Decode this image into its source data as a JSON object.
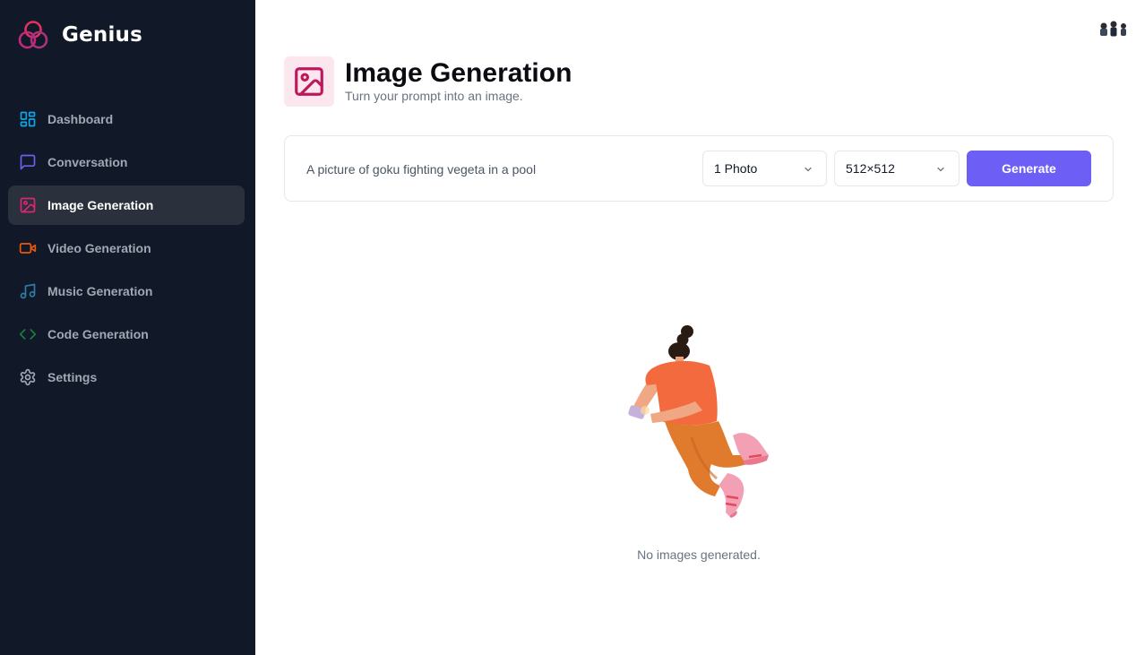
{
  "brand": {
    "name": "Genius"
  },
  "sidebar": {
    "items": [
      {
        "label": "Dashboard",
        "icon": "layout-dashboard-icon",
        "color": "#0ea5e9"
      },
      {
        "label": "Conversation",
        "icon": "message-square-icon",
        "color": "#6d5ef5"
      },
      {
        "label": "Image Generation",
        "icon": "image-icon",
        "color": "#db2777",
        "active": true
      },
      {
        "label": "Video Generation",
        "icon": "video-icon",
        "color": "#ea580c"
      },
      {
        "label": "Music Generation",
        "icon": "music-icon",
        "color": "#2f7da8"
      },
      {
        "label": "Code Generation",
        "icon": "code-icon",
        "color": "#15803d"
      },
      {
        "label": "Settings",
        "icon": "settings-gear-icon",
        "color": "#a1a7b3"
      }
    ]
  },
  "header": {
    "title": "Image Generation",
    "subtitle": "Turn your prompt into an image.",
    "icon": "image-icon",
    "icon_color": "#be185d",
    "icon_bg": "#fce7ee"
  },
  "form": {
    "prompt_value": "A picture of goku fighting vegeta in a pool",
    "amount_selected": "1 Photo",
    "resolution_selected": "512×512",
    "generate_label": "Generate",
    "button_color": "#6d5ef5"
  },
  "empty_state": {
    "message": "No images generated."
  }
}
